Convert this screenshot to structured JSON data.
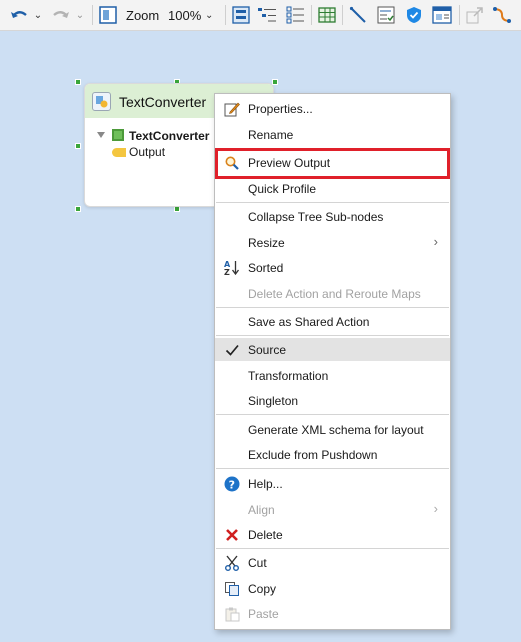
{
  "toolbar": {
    "zoom_label": "Zoom",
    "zoom_value": "100%"
  },
  "node": {
    "title": "TextConverter",
    "tree": {
      "root_label": "TextConverter",
      "child_label": "Output"
    }
  },
  "context_menu": {
    "items": {
      "properties": "Properties...",
      "rename": "Rename",
      "preview_output": "Preview Output",
      "quick_profile": "Quick Profile",
      "collapse_tree": "Collapse Tree Sub-nodes",
      "resize": "Resize",
      "sorted": "Sorted",
      "delete_action": "Delete Action and Reroute Maps",
      "save_shared": "Save as Shared Action",
      "source": "Source",
      "transformation": "Transformation",
      "singleton": "Singleton",
      "generate_xml": "Generate XML schema for layout",
      "exclude_pushdown": "Exclude from Pushdown",
      "help": "Help...",
      "align": "Align",
      "delete": "Delete",
      "cut": "Cut",
      "copy": "Copy",
      "paste": "Paste"
    },
    "highlighted_item": "Preview Output",
    "checked_item": "Source"
  },
  "colors": {
    "canvas_bg": "#cddff3",
    "node_header": "#dcefd4",
    "highlight": "#e0202a",
    "help_icon": "#1e73c8",
    "delete_icon": "#d01f1f"
  }
}
